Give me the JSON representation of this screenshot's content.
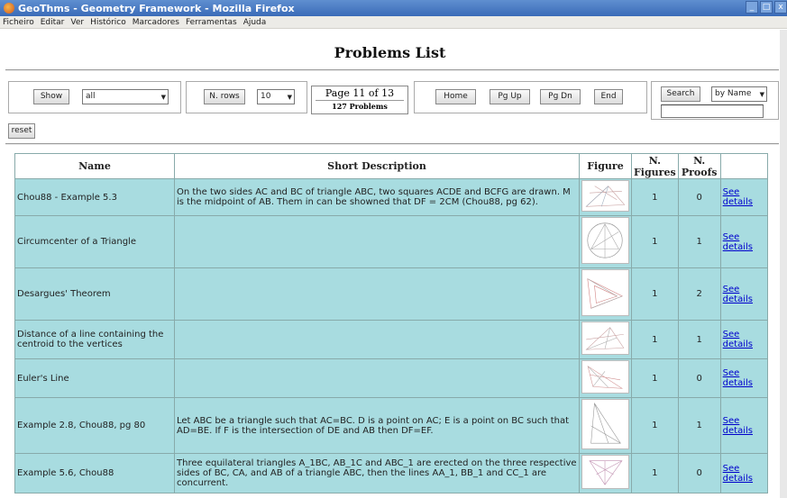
{
  "window": {
    "title": "GeoThms - Geometry Framework - Mozilla Firefox",
    "controls": [
      "_",
      "□",
      "x"
    ]
  },
  "menu": [
    "Ficheiro",
    "Editar",
    "Ver",
    "Histórico",
    "Marcadores",
    "Ferramentas",
    "Ajuda"
  ],
  "page": {
    "title": "Problems List"
  },
  "controls": {
    "show_label": "Show",
    "show_value": "all",
    "nrows_label": "N. rows",
    "nrows_value": "10",
    "page_indicator": "Page 11 of 13",
    "problem_count": "127 Problems",
    "home_label": "Home",
    "pgup_label": "Pg Up",
    "pgdn_label": "Pg Dn",
    "end_label": "End",
    "search_label": "Search",
    "search_mode": "by Name",
    "search_value": "",
    "reset_label": "reset"
  },
  "table": {
    "headers": {
      "name": "Name",
      "desc": "Short Description",
      "figure": "Figure",
      "nfig_1": "N.",
      "nfig_2": "Figures",
      "nproof_1": "N.",
      "nproof_2": "Proofs"
    },
    "link_line1": "See",
    "link_line2": "details",
    "rows": [
      {
        "name": "Chou88 - Example 5.3",
        "desc": "On the two sides AC and BC of triangle ABC, two squares ACDE and BCFG are drawn. M is the midpoint of AB. Them in can be showned that DF = 2CM (Chou88, pg 62).",
        "figures": "1",
        "proofs": "0"
      },
      {
        "name": "Circumcenter of a Triangle",
        "desc": "",
        "figures": "1",
        "proofs": "1"
      },
      {
        "name": "Desargues' Theorem",
        "desc": "",
        "figures": "1",
        "proofs": "2"
      },
      {
        "name": "Distance of a line containing the centroid to the vertices",
        "desc": "",
        "figures": "1",
        "proofs": "1"
      },
      {
        "name": "Euler's Line",
        "desc": "",
        "figures": "1",
        "proofs": "0"
      },
      {
        "name": "Example 2.8, Chou88, pg 80",
        "desc": "Let ABC be a triangle such that AC=BC. D is a point on AC; E is a point on BC such that AD=BE. If F is the intersection of DE and AB then DF=EF.",
        "figures": "1",
        "proofs": "1"
      },
      {
        "name": "Example 5.6, Chou88",
        "desc": "Three equilateral triangles A_1BC, AB_1C and ABC_1 are erected on the three respective sides of BC, CA, and AB of a triangle ABC, then the lines AA_1, BB_1 and CC_1 are concurrent.",
        "figures": "1",
        "proofs": "0"
      }
    ]
  }
}
